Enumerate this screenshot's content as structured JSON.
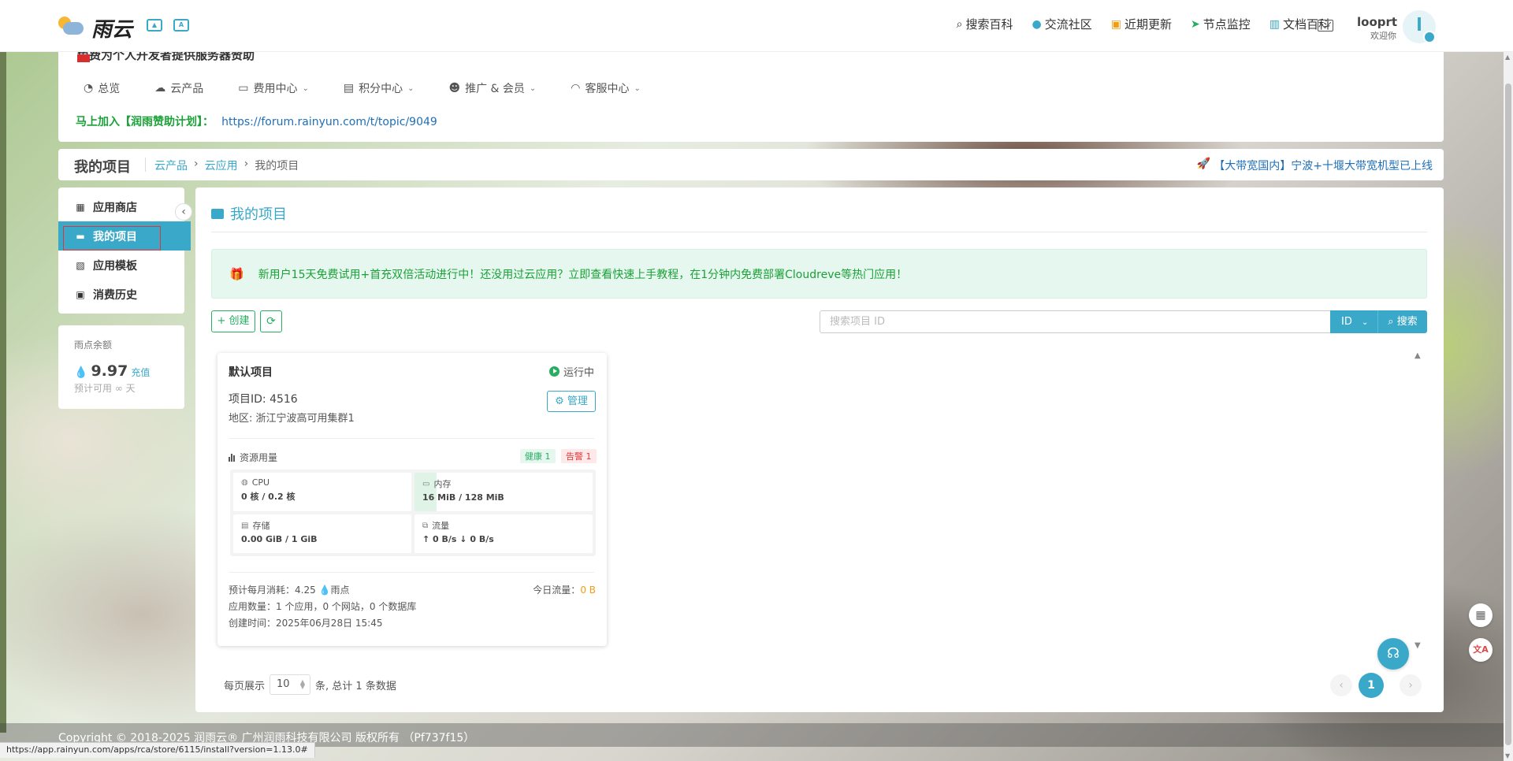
{
  "header": {
    "logo_text": "雨云",
    "nav": [
      {
        "icon": "search-icon",
        "label": "搜索百科"
      },
      {
        "icon": "qq-icon",
        "label": "交流社区"
      },
      {
        "icon": "news-icon",
        "label": "近期更新"
      },
      {
        "icon": "location-icon",
        "label": "节点监控"
      },
      {
        "icon": "book-icon",
        "label": "文档百科"
      }
    ],
    "user_name": "looprt",
    "user_greeting": "欢迎你",
    "avatar_letter": "l"
  },
  "announcement": "免费为个人开发者提供服务器赞助",
  "menu": [
    {
      "icon": "dashboard-icon",
      "label": "总览",
      "dropdown": false
    },
    {
      "icon": "cloud-products-icon",
      "label": "云产品",
      "dropdown": false
    },
    {
      "icon": "money-icon",
      "label": "费用中心",
      "dropdown": true
    },
    {
      "icon": "gift-icon",
      "label": "积分中心",
      "dropdown": true
    },
    {
      "icon": "users-icon",
      "label": "推广 & 会员",
      "dropdown": true
    },
    {
      "icon": "headset-icon",
      "label": "客服中心",
      "dropdown": true
    }
  ],
  "sponsor": {
    "label": "马上加入【润雨赞助计划】：",
    "link": "https://forum.rainyun.com/t/topic/9049"
  },
  "breadcrumb": {
    "title": "我的项目",
    "items": [
      "云产品",
      "云应用",
      "我的项目"
    ],
    "promo": "【大带宽国内】宁波+十堰大带宽机型已上线"
  },
  "sidebar": {
    "items": [
      {
        "icon": "store-icon",
        "label": "应用商店",
        "active": false
      },
      {
        "icon": "folder-icon",
        "label": "我的项目",
        "active": true
      },
      {
        "icon": "template-icon",
        "label": "应用模板",
        "active": false
      },
      {
        "icon": "history-icon",
        "label": "消费历史",
        "active": false
      }
    ],
    "collapse": "‹"
  },
  "balance": {
    "label": "雨点余额",
    "value": "9.97",
    "recharge": "充值",
    "estimate": "预计可用 ∞ 天"
  },
  "main": {
    "title": "我的项目",
    "notice": "新用户15天免费试用+首充双倍活动进行中！还没用过云应用？立即查看快速上手教程，在1分钟内免费部署Cloudreve等热门应用！",
    "create_label": "+ 创建",
    "search_placeholder": "搜索项目 ID",
    "search_field": "ID",
    "search_label": "搜索"
  },
  "project": {
    "name": "默认项目",
    "status": "运行中",
    "id_line": "项目ID: 4516",
    "region_line": "地区: 浙江宁波高可用集群1",
    "manage_label": "管理",
    "resources_label": "资源用量",
    "healthy": "健康 1",
    "warning": "告警 1",
    "cpu": {
      "label": "CPU",
      "value": "0 核 / 0.2 核",
      "usage": 0
    },
    "memory": {
      "label": "内存",
      "value": "16 MiB / 128 MiB",
      "usage": 0.125
    },
    "storage": {
      "label": "存储",
      "value": "0.00 GiB / 1 GiB",
      "usage": 0
    },
    "traffic": {
      "label": "流量",
      "value": "↑ 0 B/s ↓ 0 B/s"
    },
    "cost_prefix": "预计每月消耗：4.25 ",
    "cost_suffix": "雨点",
    "today_label": "今日流量：",
    "today_value": "0 B",
    "apps_line": "应用数量：1 个应用，0 个网站，0 个数据库",
    "created_line": "创建时间：2025年06月28日 15:45"
  },
  "pagination": {
    "per_page_label": "每页展示",
    "per_page": "10",
    "total_label": "条, 总计 1 条数据",
    "current": "1"
  },
  "footer": "Copyright © 2018-2025 润雨云® 广州润雨科技有限公司 版权所有 （Pf737f15）",
  "status_url": "https://app.rainyun.com/apps/rca/store/6115/install?version=1.13.0#",
  "colors": {
    "primary": "#3aa8c8",
    "success": "#27ae60",
    "danger": "#e23636",
    "warning": "#f39c12"
  }
}
